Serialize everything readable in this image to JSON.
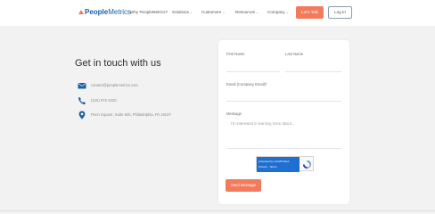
{
  "header": {
    "brand_a": "People",
    "brand_b": "Metrics",
    "nav": [
      {
        "label": "Why PeopleMetrics?"
      },
      {
        "label": "Solutions"
      },
      {
        "label": "Customers"
      },
      {
        "label": "Resources"
      },
      {
        "label": "Company"
      }
    ],
    "try_label": "Let's Talk",
    "login_label": "Log In"
  },
  "contact": {
    "headline": "Get in touch with us",
    "email": "contact@peoplemetrics.com",
    "phone": "(215) 972-1020",
    "address": "Penn Square, Suite 920, Philadelphia, PA 19107"
  },
  "form": {
    "first_name_label": "First Name",
    "last_name_label": "Last Name",
    "email_label": "Email (Company Email)*",
    "message_label": "Message",
    "message_placeholder": "I'm interested in learning more about...",
    "captcha_line1": "protected by reCAPTCHA",
    "captcha_line2": "Privacy - Terms",
    "send_label": "Send Message"
  },
  "colors": {
    "accent": "#f47a5c",
    "brand": "#1b5fa8",
    "icon": "#1b5fa8"
  }
}
